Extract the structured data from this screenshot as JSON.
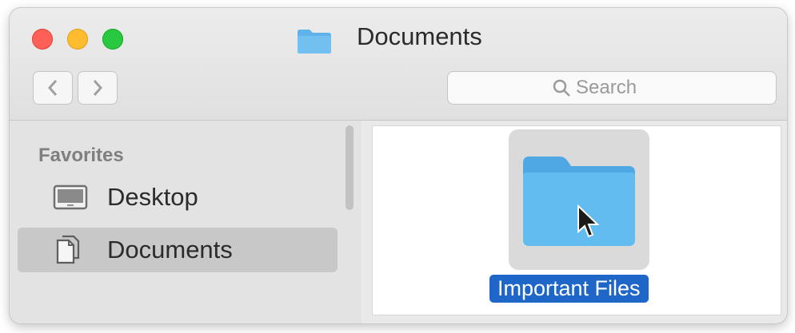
{
  "window": {
    "title": "Documents",
    "title_icon": "folder-icon",
    "traffic_lights": {
      "close": "#fe5f57",
      "minimize": "#febc2e",
      "zoom": "#28c840"
    }
  },
  "toolbar": {
    "back_icon": "chevron-left-icon",
    "forward_icon": "chevron-right-icon",
    "search": {
      "placeholder": "Search",
      "value": "",
      "icon": "magnifier-icon"
    }
  },
  "sidebar": {
    "section_title": "Favorites",
    "items": [
      {
        "label": "Desktop",
        "icon": "desktop-icon",
        "selected": false
      },
      {
        "label": "Documents",
        "icon": "document-icon",
        "selected": true
      }
    ]
  },
  "content": {
    "items": [
      {
        "name": "Important Files",
        "icon": "folder-icon",
        "selected": true
      }
    ]
  },
  "colors": {
    "selection": "#1f66c9",
    "folder": "#5fb3ea",
    "sidebar_selection": "#c8c8c8"
  }
}
